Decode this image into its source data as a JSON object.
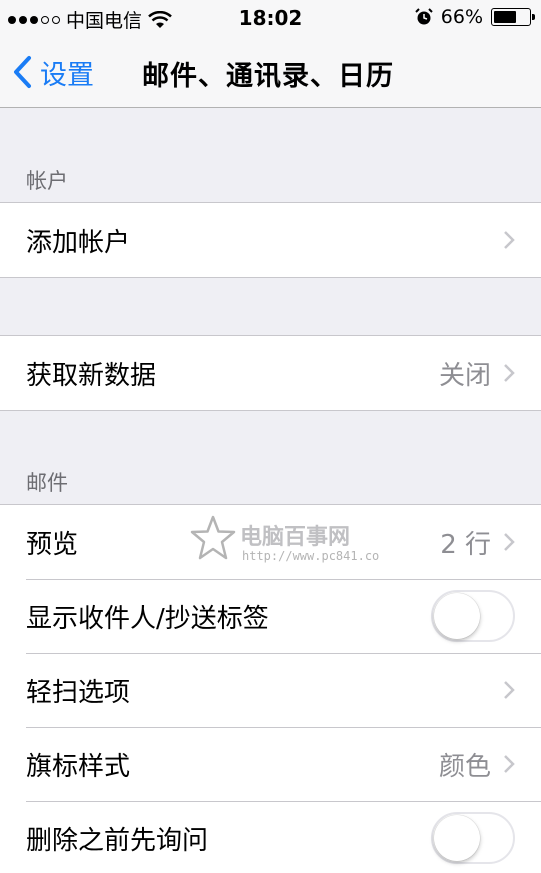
{
  "status_bar": {
    "carrier": "中国电信",
    "time": "18:02",
    "battery_percent": "66%",
    "battery_level": 0.66
  },
  "nav": {
    "back_label": "设置",
    "title": "邮件、通讯录、日历"
  },
  "sections": {
    "accounts_header": "帐户",
    "add_account": "添加帐户",
    "fetch_new_data": "获取新数据",
    "fetch_value": "关闭",
    "mail_header": "邮件",
    "preview": "预览",
    "preview_value": "2 行",
    "show_to_cc": "显示收件人/抄送标签",
    "show_to_cc_on": false,
    "swipe_options": "轻扫选项",
    "flag_style": "旗标样式",
    "flag_style_value": "颜色",
    "ask_before_delete": "删除之前先询问",
    "ask_before_delete_on": false
  },
  "watermark": {
    "name": "电脑百事网",
    "url": "http://www.pc841.co"
  },
  "colors": {
    "accent": "#1a7cf5",
    "background": "#efeff4",
    "secondary_text": "#8e8e93"
  }
}
